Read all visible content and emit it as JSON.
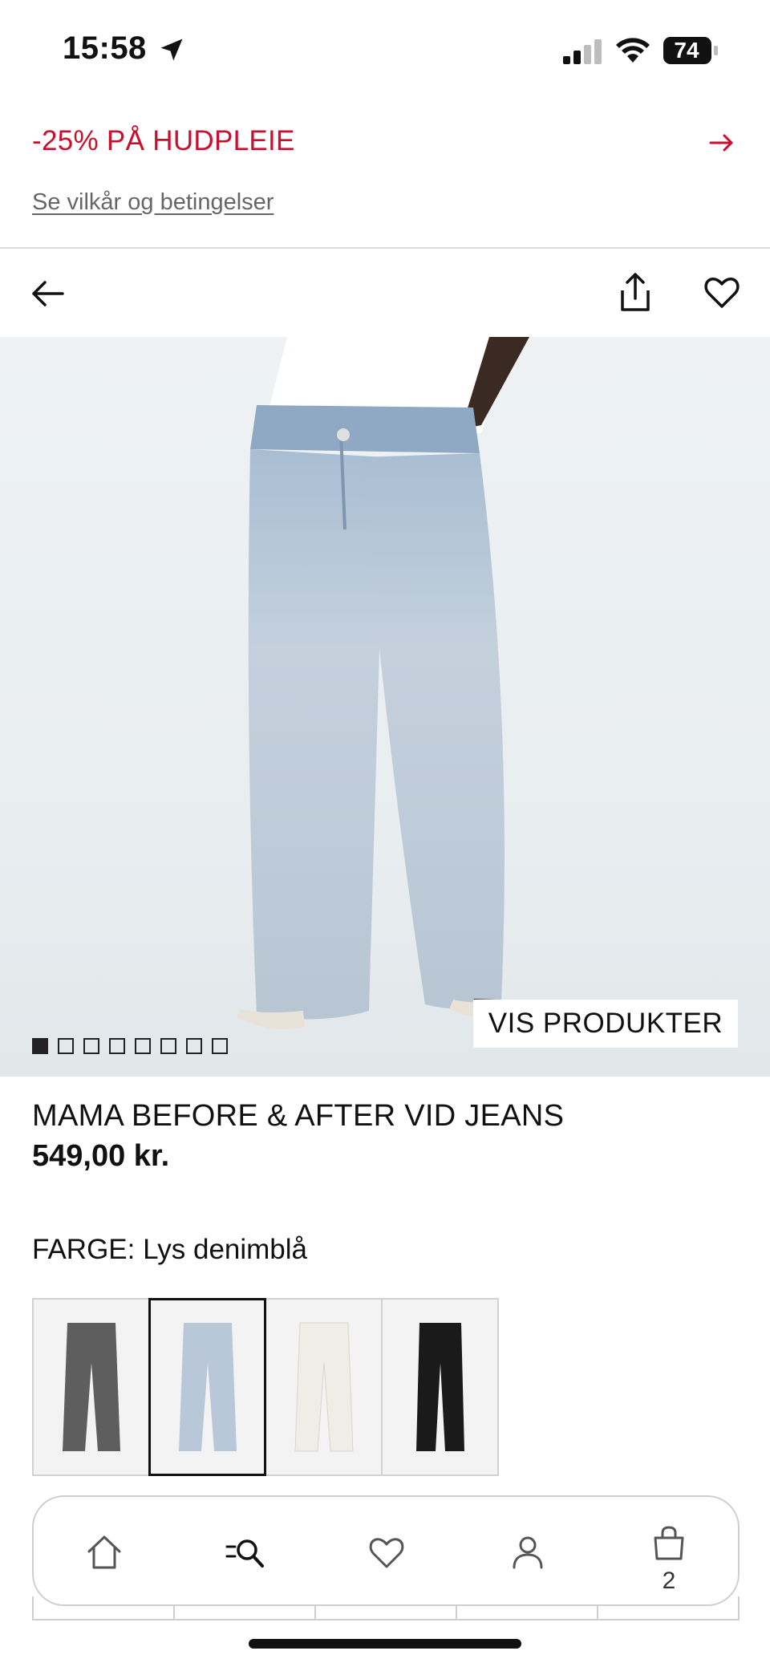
{
  "status_bar": {
    "time": "15:58",
    "battery": "74",
    "icons": [
      "location-arrow-icon",
      "signal-icon",
      "wifi-icon",
      "battery-icon"
    ]
  },
  "promo": {
    "title": "-25% PÅ HUDPLEIE",
    "terms_link": "Se vilkår og betingelser",
    "arrow_icon": "arrow-right-icon",
    "color": "#c8102e"
  },
  "nav": {
    "icons": [
      "back-arrow-icon",
      "share-icon",
      "heart-icon"
    ]
  },
  "gallery": {
    "image_count": 8,
    "active_index": 0,
    "show_products_label": "VIS PRODUKTER"
  },
  "product": {
    "title": "MAMA BEFORE & AFTER VID JEANS",
    "price": "549,00 kr.",
    "color_label": "FARGE: Lys denimblå",
    "swatches": [
      {
        "color": "#5e5e5e",
        "selected": false
      },
      {
        "color": "#b9c8d8",
        "selected": true
      },
      {
        "color": "#efede6",
        "selected": false
      },
      {
        "color": "#1a1a1a",
        "selected": false
      }
    ]
  },
  "tab_bar": {
    "tabs": [
      {
        "icon": "home-icon"
      },
      {
        "icon": "search-menu-icon"
      },
      {
        "icon": "heart-icon"
      },
      {
        "icon": "account-icon"
      },
      {
        "icon": "shopping-bag-icon",
        "badge": "2"
      }
    ]
  }
}
